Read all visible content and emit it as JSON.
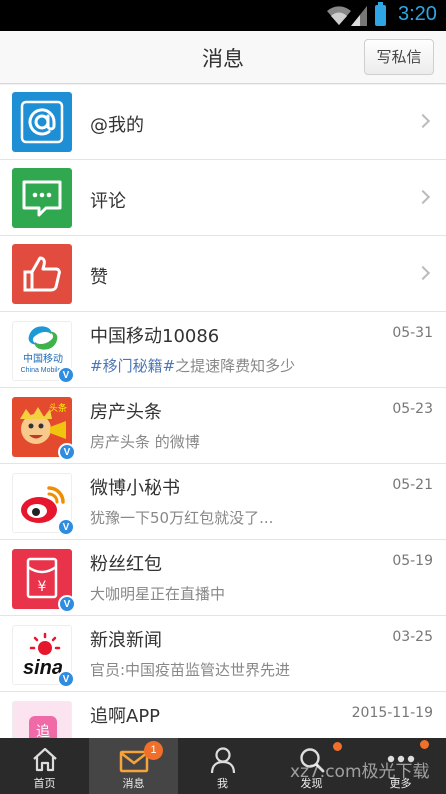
{
  "statusbar": {
    "time": "3:20"
  },
  "header": {
    "title": "消息",
    "write_button": "写私信"
  },
  "fixed_items": [
    {
      "label": "@我的",
      "icon": "at-icon",
      "color": "#1e8fd5"
    },
    {
      "label": "评论",
      "icon": "comment-icon",
      "color": "#2fa84f"
    },
    {
      "label": "赞",
      "icon": "thumbs-up-icon",
      "color": "#e24c3f"
    }
  ],
  "messages": [
    {
      "name": "中国移动10086",
      "date": "05-31",
      "topic": "#移门秘籍#",
      "text": "之提速降费知多少",
      "avatar_label": "中国移动",
      "avatar_sub": "China Mobile"
    },
    {
      "name": "房产头条",
      "date": "05-23",
      "text": "房产头条 的微博",
      "avatar_tag": "头条"
    },
    {
      "name": "微博小秘书",
      "date": "05-21",
      "text": "犹豫一下50万红包就没了..."
    },
    {
      "name": "粉丝红包",
      "date": "05-19",
      "text": "大咖明星正在直播中",
      "avatar_symbol": "¥"
    },
    {
      "name": "新浪新闻",
      "date": "03-25",
      "text": "官员:中国疫苗监管达世界先进",
      "avatar_label": "sina"
    },
    {
      "name": "追啊APP",
      "date": "2015-11-19",
      "text": "",
      "avatar_label": "追"
    }
  ],
  "tabs": [
    {
      "label": "首页",
      "icon": "home-icon"
    },
    {
      "label": "消息",
      "icon": "envelope-icon",
      "badge": "1"
    },
    {
      "label": "我",
      "icon": "profile-icon"
    },
    {
      "label": "发现",
      "icon": "search-icon"
    },
    {
      "label": "更多",
      "icon": "more-icon"
    }
  ],
  "watermark": "xz7.com极光下载"
}
